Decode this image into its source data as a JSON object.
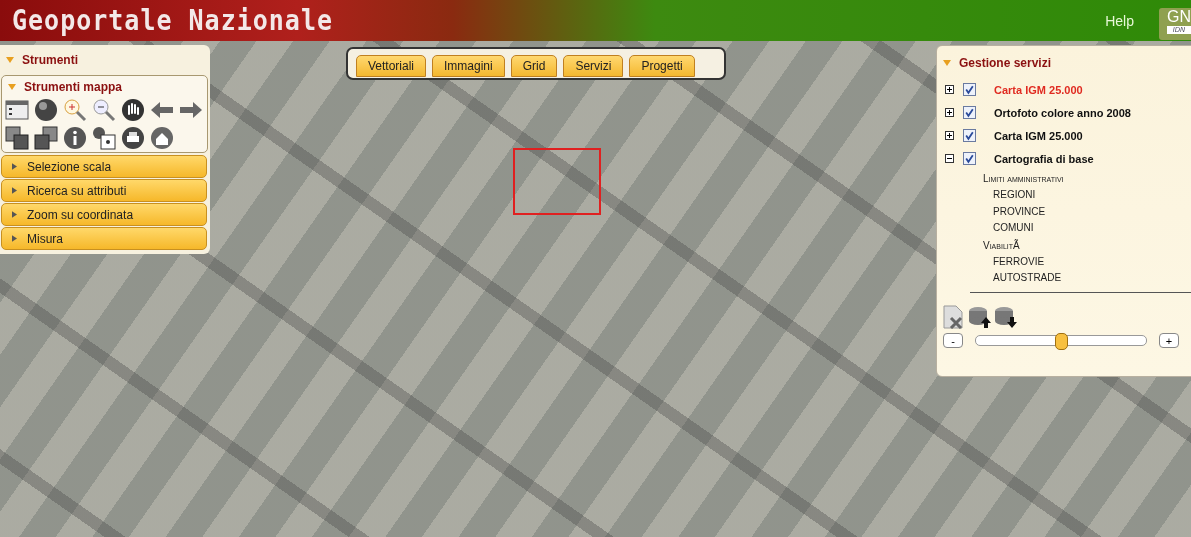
{
  "header": {
    "title": "Geoportale Nazionale",
    "help": "Help",
    "logo": {
      "main": "GN",
      "sub": "IDN"
    }
  },
  "tools_panel": {
    "title": "Strumenti",
    "map_tools": {
      "title": "Strumenti mappa",
      "expanded": true
    },
    "sections": [
      {
        "label": "Selezione scala",
        "expanded": false
      },
      {
        "label": "Ricerca su attributi",
        "expanded": false
      },
      {
        "label": "Zoom su coordinata",
        "expanded": false
      },
      {
        "label": "Misura",
        "expanded": false
      }
    ]
  },
  "tabs": [
    {
      "label": "Vettoriali",
      "selected": false
    },
    {
      "label": "Immagini",
      "selected": false
    },
    {
      "label": "Grid",
      "selected": false
    },
    {
      "label": "Servizi",
      "selected": false
    },
    {
      "label": "Progetti",
      "selected": false
    }
  ],
  "services_panel": {
    "title": "Gestione servizi",
    "layers": [
      {
        "name": "Carta IGM 25.000",
        "checked": true,
        "expanded": false,
        "selected": true
      },
      {
        "name": "Ortofoto colore anno 2008",
        "checked": true,
        "expanded": false,
        "selected": false
      },
      {
        "name": "Carta IGM 25.000",
        "checked": true,
        "expanded": false,
        "selected": false
      },
      {
        "name": "Cartografia di base",
        "checked": true,
        "expanded": true,
        "selected": false,
        "children": [
          {
            "name": "Limiti amministrativi",
            "children": [
              {
                "name": "REGIONI"
              },
              {
                "name": "PROVINCE"
              },
              {
                "name": "COMUNI"
              }
            ]
          },
          {
            "name": "ViabilitÃ",
            "children": [
              {
                "name": "FERROVIE"
              },
              {
                "name": "AUTOSTRADE"
              }
            ]
          }
        ]
      }
    ],
    "minus": "-",
    "plus": "+",
    "opacity": {
      "level": 0.5
    }
  }
}
